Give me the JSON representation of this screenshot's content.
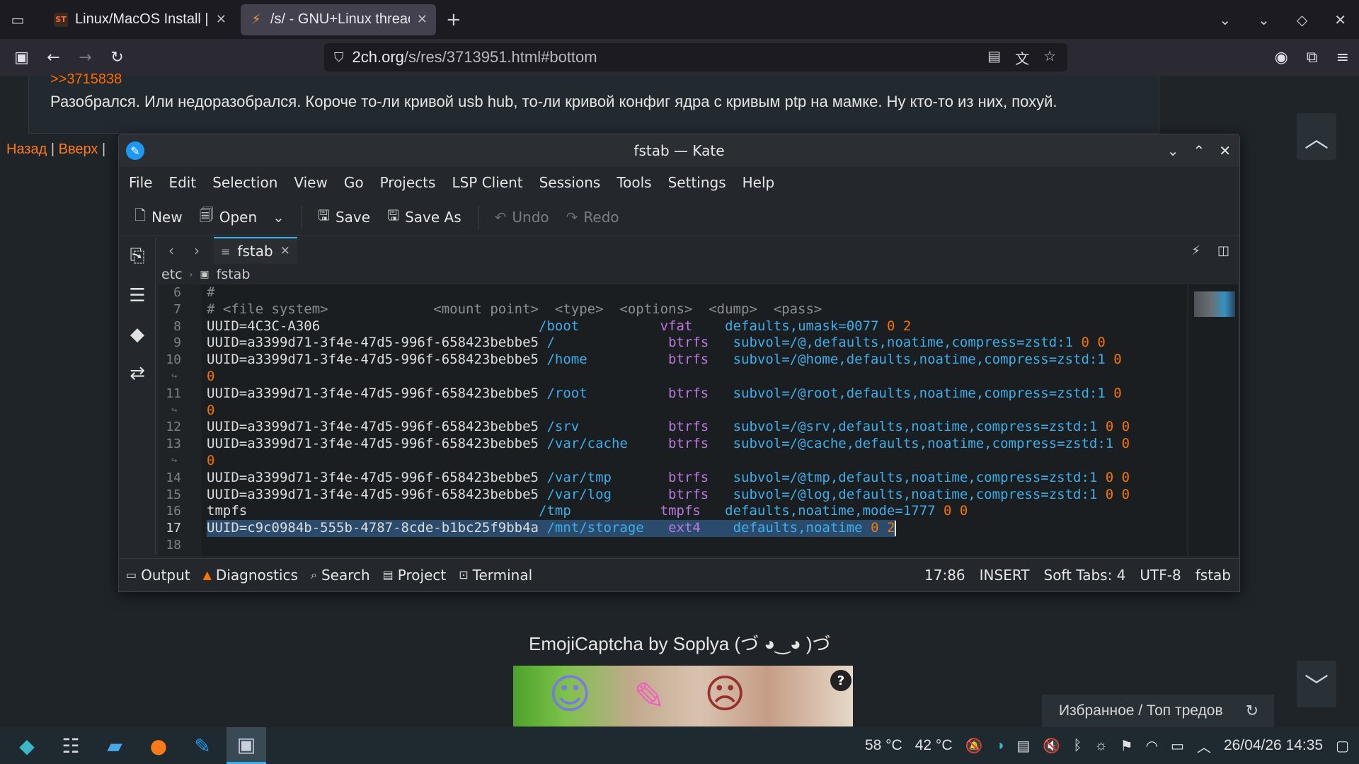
{
  "browser": {
    "tabs": [
      {
        "title": "Linux/MacOS Install | (",
        "favicon": "ST"
      },
      {
        "title": "/s/ - GNU+Linux threac",
        "favicon": "⚡"
      }
    ],
    "url": {
      "host": "2ch.org",
      "path": "/s/res/3713951.html#bottom"
    }
  },
  "page": {
    "quote_link": ">>3715838",
    "post_text": "Разобрался. Или недоразобрался. Короче то-ли кривой usb hub, то-ли кривой конфиг ядра с кривым ptp на мамке. Ну кто-то из них, похуй.",
    "links": {
      "back": "Назад",
      "sep1": " | ",
      "up": "Вверх",
      "sep2": " |"
    },
    "captcha_title": "EmojiCaptcha by Soplya (づ ◕‿◕ )づ",
    "captcha_help": "?",
    "favorites": "Избранное / Топ тредов"
  },
  "kate": {
    "title": "fstab — Kate",
    "menu": [
      "File",
      "Edit",
      "Selection",
      "View",
      "Go",
      "Projects",
      "LSP Client",
      "Sessions",
      "Tools",
      "Settings",
      "Help"
    ],
    "toolbar": {
      "new": "New",
      "open": "Open",
      "save": "Save",
      "save_as": "Save As",
      "undo": "Undo",
      "redo": "Redo"
    },
    "tab_name": "fstab",
    "breadcrumb": {
      "dir": "etc",
      "file": "fstab"
    },
    "code": {
      "l6": "#",
      "l7": "# <file system>             <mount point>  <type>  <options>  <dump>  <pass>",
      "l8a": "UUID=4C3C-A306",
      "l8mp": "/boot",
      "l8ty": "vfat",
      "l8op": "defaults,umask=0077",
      "l8n": "0 2",
      "uuid": "UUID=a3399d71-3f4e-47d5-996f-658423bebbe5",
      "l9mp": "/",
      "l9ty": "btrfs",
      "l9op": "subvol=/@,defaults,noatime,compress=zstd:1",
      "l9n": "0 0",
      "l10mp": "/home",
      "l10op": "subvol=/@home,defaults,noatime,compress=zstd:1",
      "l10n": "0",
      "l10w": "0",
      "l11mp": "/root",
      "l11op": "subvol=/@root,defaults,noatime,compress=zstd:1",
      "l11n": "0",
      "l11w": "0",
      "l12mp": "/srv",
      "l12op": "subvol=/@srv,defaults,noatime,compress=zstd:1",
      "l12n": "0 0",
      "l13mp": "/var/cache",
      "l13op": "subvol=/@cache,defaults,noatime,compress=zstd:1",
      "l13n": "0",
      "l13w": "0",
      "l14mp": "/var/tmp",
      "l14op": "subvol=/@tmp,defaults,noatime,compress=zstd:1",
      "l14n": "0 0",
      "l15mp": "/var/log",
      "l15op": "subvol=/@log,defaults,noatime,compress=zstd:1",
      "l15n": "0 0",
      "l16a": "tmpfs",
      "l16mp": "/tmp",
      "l16ty": "tmpfs",
      "l16op": "defaults,noatime,mode=1777",
      "l16n": "0 0",
      "l17a": "UUID=c9c0984b-555b-4787-8cde-b1bc25f9bb4a",
      "l17mp": "/mnt/storage",
      "l17ty": "ext4",
      "l17op": "defaults,noatime",
      "l17n": "0 2",
      "btrfs": "btrfs"
    },
    "line_numbers": [
      "6",
      "7",
      "8",
      "9",
      "10",
      "11",
      "12",
      "13",
      "14",
      "15",
      "16",
      "17",
      "18"
    ],
    "status": {
      "output": "Output",
      "diagnostics": "Diagnostics",
      "search": "Search",
      "project": "Project",
      "terminal": "Terminal",
      "position": "17:86",
      "mode": "INSERT",
      "tabs": "Soft Tabs: 4",
      "encoding": "UTF-8",
      "filetype": "fstab"
    }
  },
  "taskbar": {
    "temp1": "58 °C",
    "temp2": "42 °C",
    "datetime": "26/04/26 14:35"
  }
}
